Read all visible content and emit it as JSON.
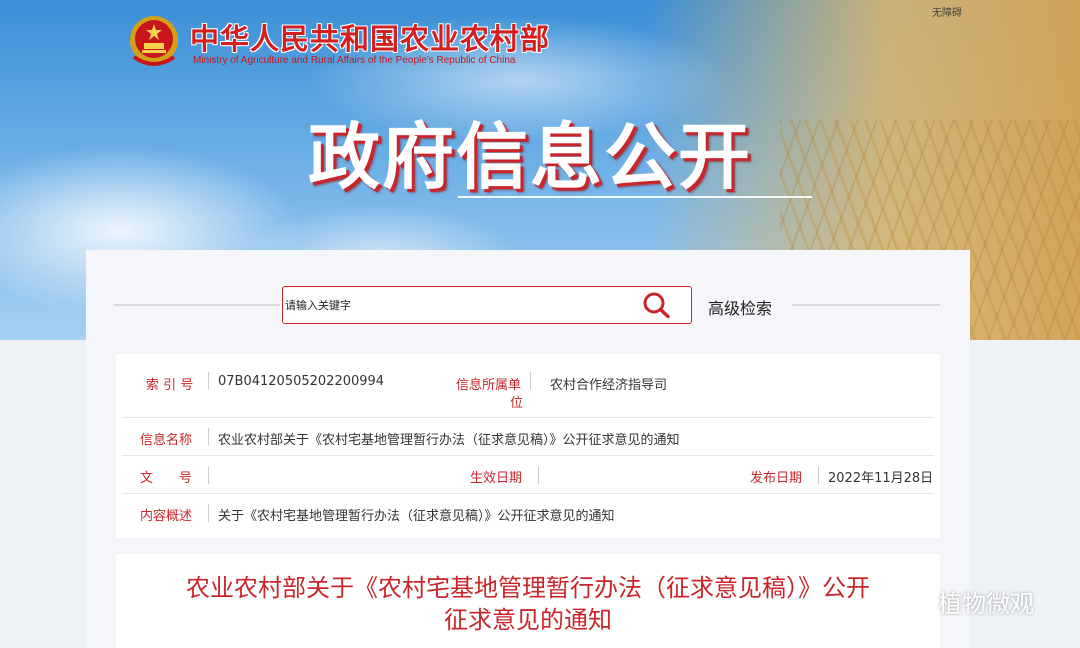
{
  "header": {
    "ministry_cn": "中华人民共和国农业农村部",
    "ministry_en": "Ministry of Agriculture and Rural Affairs of the People's Republic of China",
    "accessibility": "无障碍",
    "banner_title": "政府信息公开"
  },
  "search": {
    "placeholder": "请输入关键字",
    "advanced": "高级检索"
  },
  "info": {
    "index_label": "索 引 号",
    "index_value": "07B04120505202200994",
    "unit_label_1": "信息所属单",
    "unit_label_2": "位",
    "unit_value": "农村合作经济指导司",
    "name_label": "信息名称",
    "name_value": "农业农村部关于《农村宅基地管理暂行办法（征求意见稿）》公开征求意见的通知",
    "docno_label": "文　　号",
    "effective_label": "生效日期",
    "publish_label": "发布日期",
    "publish_value": "2022年11月28日",
    "summary_label": "内容概述",
    "summary_value": "关于《农村宅基地管理暂行办法（征求意见稿）》公开征求意见的通知"
  },
  "article": {
    "title_line1": "农业农村部关于《农村宅基地管理暂行办法（征求意见稿）》公开",
    "title_line2": "征求意见的通知"
  },
  "watermark": {
    "text": "植物微观"
  },
  "colors": {
    "accent_red": "#c9262b",
    "sky_blue": "#3b8fd6"
  }
}
